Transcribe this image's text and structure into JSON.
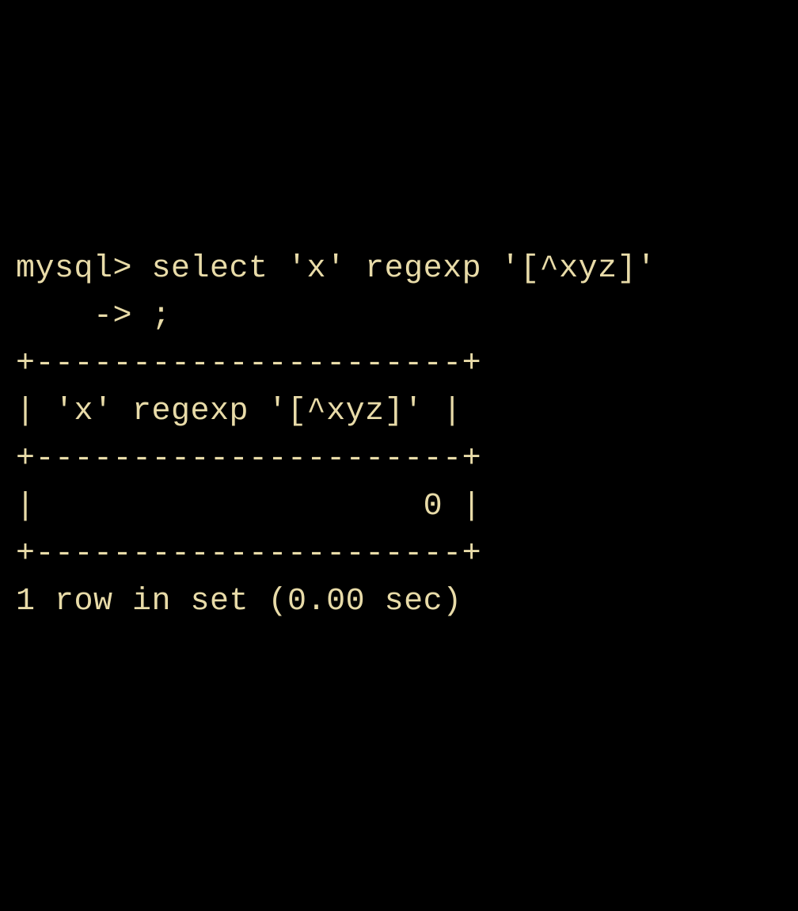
{
  "terminal": {
    "line1": "mysql> select 'x' regexp '[^xyz]'",
    "line2": "    -> ;",
    "line3": "+----------------------+",
    "line4": "| 'x' regexp '[^xyz]' |",
    "line5": "+----------------------+",
    "line6": "|                    0 |",
    "line7": "+----------------------+",
    "line8": "1 row in set (0.00 sec)"
  }
}
